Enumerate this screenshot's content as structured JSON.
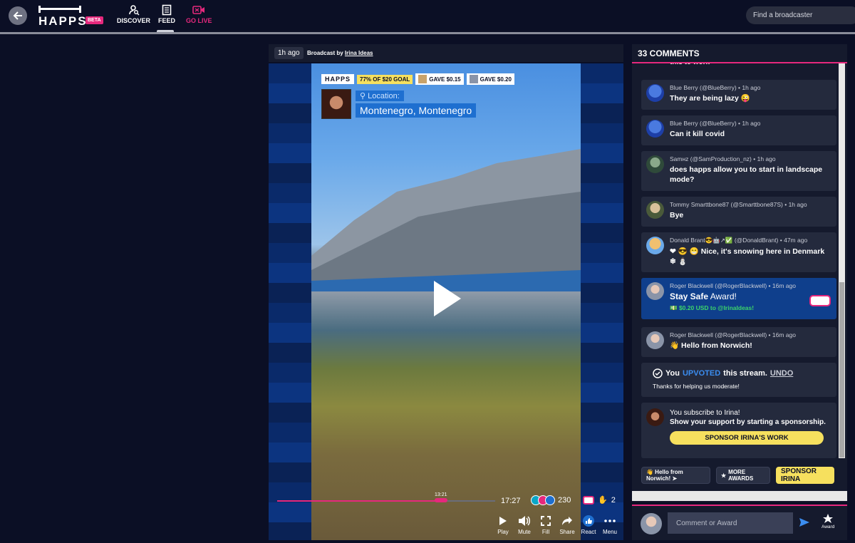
{
  "nav": {
    "brand": "HAPPS",
    "beta": "BETA",
    "items": [
      {
        "label": "DISCOVER",
        "icon": "discover-icon"
      },
      {
        "label": "FEED",
        "icon": "feed-icon"
      },
      {
        "label": "GO LIVE",
        "icon": "go-live-icon"
      }
    ],
    "search_placeholder": "Find a broadcaster"
  },
  "video": {
    "time_ago": "1h ago",
    "broadcast_by_prefix": "Broadcast by",
    "broadcaster": "Irina Ideas",
    "overlay": {
      "logo": "HAPPS",
      "goal": "77% OF $20 GOAL",
      "gave1": "GAVE $0.15",
      "gave2": "GAVE $0.20",
      "location_label": "Location:",
      "location_value": "Montenegro, Montenegro"
    },
    "progress": 0.75,
    "current_time": "13:21",
    "duration": "17:27",
    "viewer_count": "230",
    "mask_count": "2",
    "controls": [
      {
        "label": "Play",
        "icon": "play-icon"
      },
      {
        "label": "Mute",
        "icon": "volume-icon"
      },
      {
        "label": "Fill",
        "icon": "fill-icon"
      },
      {
        "label": "Share",
        "icon": "share-icon"
      },
      {
        "label": "React",
        "icon": "react-icon"
      },
      {
        "label": "Menu",
        "icon": "menu-icon"
      }
    ]
  },
  "comments": {
    "header": "33 COMMENTS",
    "cutoff_text": "this to work",
    "items": [
      {
        "author": "Blue Berry (@BlueBerry)",
        "time": "1h ago",
        "text": "They are being lazy 😜",
        "avatar_color": "#1d3fa8"
      },
      {
        "author": "Blue Berry (@BlueBerry)",
        "time": "1h ago",
        "text": "Can it kill covid",
        "avatar_color": "#1d3fa8"
      },
      {
        "author": "Samнz (@SamProduction_nz)",
        "time": "1h ago",
        "text": "does happs allow you to start in landscape mode?",
        "avatar_color": "#2f4a3a"
      },
      {
        "author": "Tommy Smarttbone87 (@Smarttbone87S)",
        "time": "1h ago",
        "text": "Bye",
        "avatar_color": "#6a5a4a"
      },
      {
        "author": "Donald Brant😎🤖↗✅ (@DonaldBrant)",
        "time": "47m ago",
        "text": "❤ 😎 😁 Nice, it's snowing here in Denmark ❄ ⛄",
        "avatar_color": "#d6a35a"
      },
      {
        "author": "Roger Blackwell (@RogerBlackwell)",
        "time": "16m ago",
        "award_title_bold": "Stay Safe",
        "award_title_rest": " Award!",
        "award_amount": "$0.20 USD to ",
        "award_to": "@IrinaIdeas!",
        "avatar_color": "#8a94a8"
      },
      {
        "author": "Roger Blackwell (@RogerBlackwell)",
        "time": "16m ago",
        "text": "👋 Hello from Norwich!",
        "avatar_color": "#8a94a8"
      }
    ],
    "upvote": {
      "you": "You",
      "upvoted": "UPVOTED",
      "rest": "this stream.",
      "undo": "UNDO",
      "thanks": "Thanks for helping us moderate!"
    },
    "subscribe": {
      "line1": "You subscribe to Irina!",
      "line2": "Show your support by starting a sponsorship.",
      "button": "SPONSOR IRINA'S WORK"
    },
    "quick_actions": {
      "hello": "👋 Hello from Norwich! ➤",
      "more_awards": "MORE AWARDS",
      "sponsor": "SPONSOR IRINA"
    },
    "input_placeholder": "Comment or Award",
    "award_label": "Award"
  },
  "colors": {
    "accent_pink": "#e6287d",
    "sponsor_yellow": "#f6e05e",
    "upvote_blue": "#3b8df0",
    "panel_bg": "#151a2d",
    "card_bg": "#242a3d"
  }
}
